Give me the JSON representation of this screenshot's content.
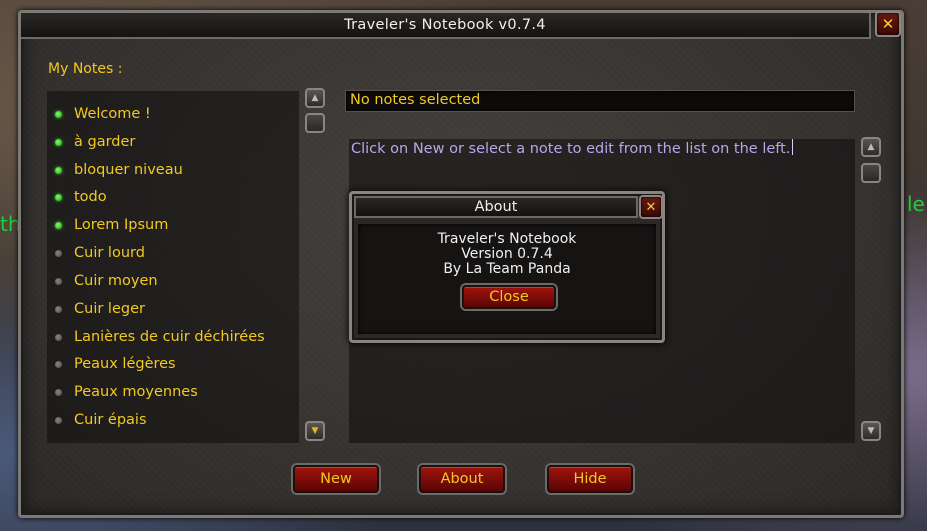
{
  "window": {
    "title": "Traveler's Notebook v0.7.4"
  },
  "notes": {
    "label": "My Notes :",
    "items": [
      {
        "label": "Welcome !",
        "status": "active"
      },
      {
        "label": "à garder",
        "status": "active"
      },
      {
        "label": "bloquer niveau",
        "status": "active"
      },
      {
        "label": "todo",
        "status": "active"
      },
      {
        "label": "Lorem Ipsum",
        "status": "active"
      },
      {
        "label": "Cuir lourd",
        "status": "inactive"
      },
      {
        "label": "Cuir moyen",
        "status": "inactive"
      },
      {
        "label": "Cuir leger",
        "status": "inactive"
      },
      {
        "label": "Lanières de cuir déchirées",
        "status": "inactive"
      },
      {
        "label": "Peaux légères",
        "status": "inactive"
      },
      {
        "label": "Peaux moyennes",
        "status": "inactive"
      },
      {
        "label": "Cuir épais",
        "status": "inactive"
      }
    ]
  },
  "editor": {
    "title_value": "No notes selected",
    "body_text": "Click on New or select a note to edit from the list on the left."
  },
  "about": {
    "title": "About",
    "lines": [
      "Traveler's Notebook",
      "Version 0.7.4",
      "By La Team Panda"
    ],
    "close_label": "Close"
  },
  "buttons": {
    "new_label": "New",
    "about_label": "About",
    "hide_label": "Hide"
  },
  "background": {
    "left_text": "th",
    "right_text": "le"
  },
  "colors": {
    "gold": "#f2c91f",
    "lavender": "#b9a6ea",
    "red_button": "#a1140c",
    "green_dot": "#38c42a"
  },
  "icons": {
    "close": "close-x-icon",
    "scroll_up": "scroll-up-icon",
    "scroll_down": "scroll-down-icon"
  }
}
